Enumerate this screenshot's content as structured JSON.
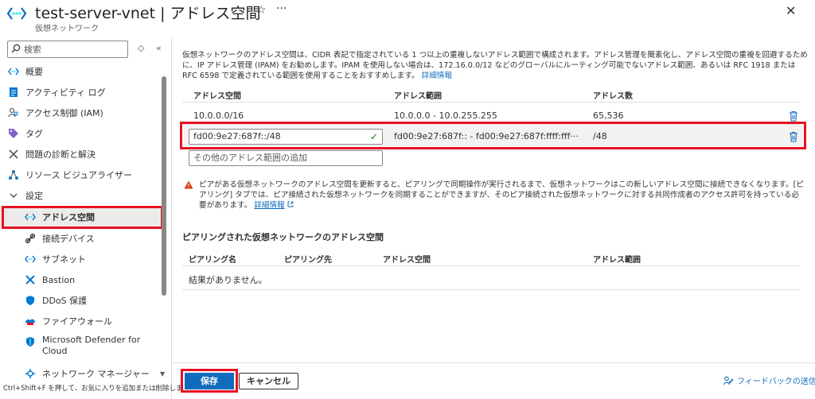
{
  "header": {
    "title": "test-server-vnet | アドレス空間",
    "subtitle": "仮想ネットワーク",
    "favorite_glyph": "☆",
    "more_glyph": "···",
    "close_glyph": "✕"
  },
  "sidebar": {
    "search_placeholder": "検索",
    "expand_glyph": "◇",
    "collapse_glyph": "«",
    "items": [
      {
        "label": "概要",
        "icon": "vnet-icon",
        "level": 0
      },
      {
        "label": "アクティビティ ログ",
        "icon": "activity-log-icon",
        "level": 0
      },
      {
        "label": "アクセス制御 (IAM)",
        "icon": "iam-icon",
        "level": 0
      },
      {
        "label": "タグ",
        "icon": "tag-icon",
        "level": 0
      },
      {
        "label": "問題の診断と解決",
        "icon": "wrench-icon",
        "level": 0
      },
      {
        "label": "リソース ビジュアライザー",
        "icon": "visualizer-icon",
        "level": 0
      },
      {
        "label": "設定",
        "icon": "chevron-down-icon",
        "level": 0
      },
      {
        "label": "アドレス空間",
        "icon": "vnet-icon",
        "level": 1,
        "active": true
      },
      {
        "label": "接続デバイス",
        "icon": "plug-icon",
        "level": 1
      },
      {
        "label": "サブネット",
        "icon": "subnet-icon",
        "level": 1
      },
      {
        "label": "Bastion",
        "icon": "bastion-icon",
        "level": 1
      },
      {
        "label": "DDoS 保護",
        "icon": "shield-icon",
        "level": 1
      },
      {
        "label": "ファイアウォール",
        "icon": "firewall-icon",
        "level": 1
      },
      {
        "label": "Microsoft Defender for",
        "label2": "Cloud",
        "icon": "defender-icon",
        "level": 1
      },
      {
        "label": "ネットワーク マネージャー",
        "icon": "network-manager-icon",
        "level": 1
      }
    ],
    "tooltip": "Ctrl+Shift+F を押して、お気に入りを追加または削除しま"
  },
  "main": {
    "description": "仮想ネットワークのアドレス空間は、CIDR 表記で指定されている 1 つ以上の重複しないアドレス範囲で構成されます。アドレス管理を簡素化し、アドレス空間の重複を回避するために、IP アドレス管理 (IPAM) をお勧めします。IPAM を使用しない場合は、172.16.0.0/12 などのグローバルにルーティング可能でないアドレス範囲、あるいは RFC 1918 または RFC 6598 で定義されている範囲を使用することをおすすめします。",
    "learn_more": "詳細情報",
    "table": {
      "columns": [
        "アドレス空間",
        "アドレス範囲",
        "アドレス数"
      ],
      "rows": [
        {
          "space": "10.0.0.0/16",
          "range": "10.0.0.0 - 10.0.255.255",
          "count": "65,536"
        },
        {
          "space": "fd00:9e27:687f::/48",
          "range": "fd00:9e27:687f:: - fd00:9e27:687f:ffff:fff···",
          "count": "/48",
          "editing": true
        }
      ],
      "add_placeholder": "その他のアドレス範囲の追加"
    },
    "warning": "ピアがある仮想ネットワークのアドレス空間を更新すると、ピアリングで同期操作が実行されるまで、仮想ネットワークはこの新しいアドレス空間に接続できなくなります。[ピアリング] タブでは、ピア接続された仮想ネットワークを同期することができますが、そのピア接続された仮想ネットワークに対する共同作成者のアクセス許可を持っている必要があります。",
    "warning_link": "詳細情報",
    "peered_title": "ピアリングされた仮想ネットワークのアドレス空間",
    "peered_columns": [
      "ピアリング名",
      "ピアリング先",
      "アドレス空間",
      "アドレス範囲"
    ],
    "no_results": "結果がありません。"
  },
  "footer": {
    "save": "保存",
    "cancel": "キャンセル",
    "feedback": "フィードバックの送信"
  },
  "colors": {
    "accent": "#0f6cbd",
    "highlight": "#e81123",
    "warning": "#d83b01",
    "success": "#107c10"
  }
}
